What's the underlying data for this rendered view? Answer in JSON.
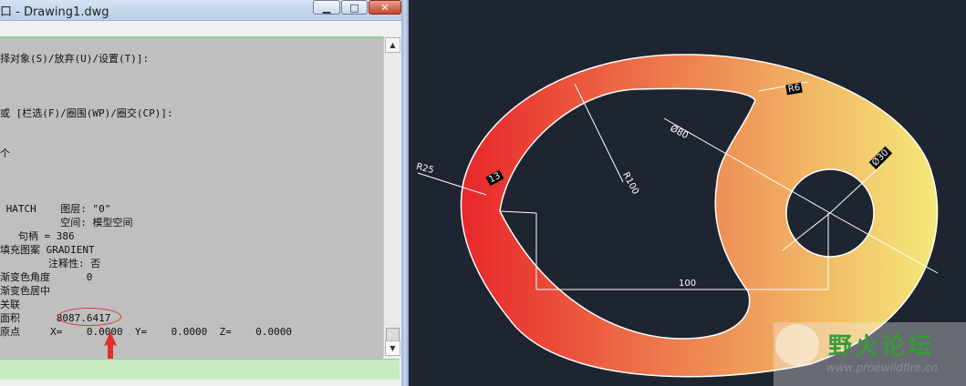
{
  "window": {
    "title": "口 - Drawing1.dwg",
    "minimize_glyph": "▁",
    "maximize_glyph": "□",
    "close_glyph": "✕"
  },
  "command_lines": [
    "择对象(S)/放弃(U)/设置(T)]:",
    "或 [栏选(F)/圈围(WP)/圈交(CP)]:",
    "个",
    " HATCH    图层: \"0\"",
    "          空间: 模型空间",
    "   句柄 = 386",
    "填充图案 GRADIENT",
    "        注释性: 否",
    "渐变色角度      0",
    "渐变色居中",
    "关联",
    "面积      8087.6417",
    "原点     X=    0.0000  Y=    0.0000  Z=    0.0000"
  ],
  "annotation": {
    "circle_color": "#dd3333",
    "arrow_color": "#e0302a"
  },
  "drawing": {
    "background": "#1e2430",
    "gradient_start": "#e8262a",
    "gradient_end": "#f4ea7a",
    "dims": {
      "r6": "R6",
      "d80": "Ø80",
      "d30": "Ø30",
      "r25": "R25",
      "w13": "13",
      "r100": "R100",
      "len100": "100"
    }
  },
  "watermark": {
    "site_name": "野火论坛",
    "url": "www.proewildfire.cn"
  }
}
